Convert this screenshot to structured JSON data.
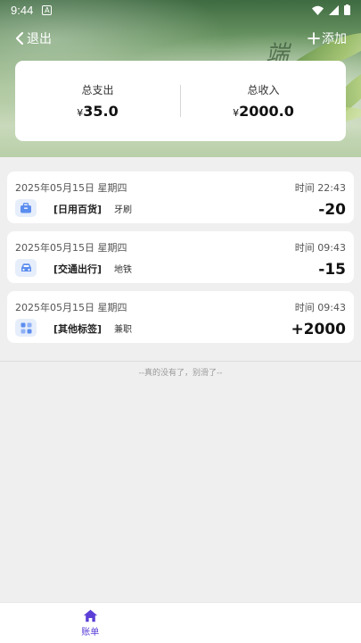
{
  "status_bar": {
    "time": "9:44",
    "app_badge": "A"
  },
  "header": {
    "back_label": "退出",
    "add_label": "添加",
    "decor_text": "端"
  },
  "summary": {
    "expense_label": "总支出",
    "expense_currency": "¥",
    "expense_value": "35.0",
    "income_label": "总收入",
    "income_currency": "¥",
    "income_value": "2000.0"
  },
  "records": [
    {
      "date": "2025年05月15日 星期四",
      "time": "时间 22:43",
      "category": "[日用百货]",
      "note": "牙刷",
      "amount": "-20",
      "icon": "shopping-bag-icon",
      "icon_color": "#5b8def"
    },
    {
      "date": "2025年05月15日 星期四",
      "time": "时间 09:43",
      "category": "[交通出行]",
      "note": "地铁",
      "amount": "-15",
      "icon": "car-icon",
      "icon_color": "#5b8def"
    },
    {
      "date": "2025年05月15日 星期四",
      "time": "时间 09:43",
      "category": "[其他标签]",
      "note": "兼职",
      "amount": "+2000",
      "icon": "grid-icon",
      "icon_color": "#5b8def"
    }
  ],
  "end_hint": "--真的没有了，别滑了--",
  "tabbar": {
    "tabs": [
      {
        "label": "账单",
        "icon": "home-icon",
        "active": true
      },
      {
        "label": "",
        "icon": "",
        "active": false
      }
    ],
    "accent": "#5b3fd6"
  }
}
